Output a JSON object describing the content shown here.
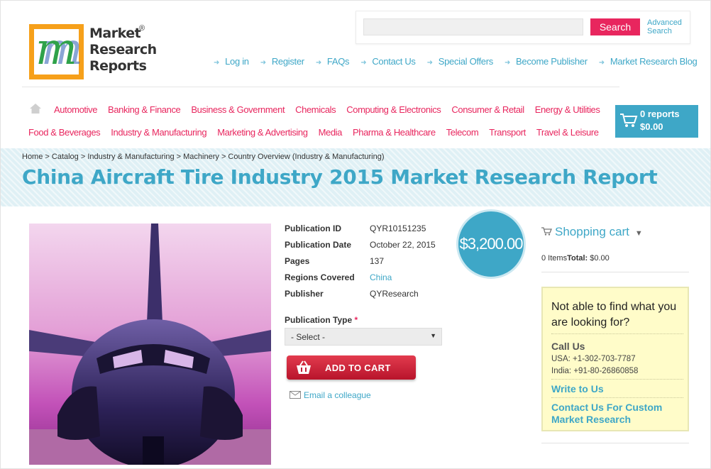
{
  "logo": {
    "line1": "Market",
    "line2": "Research",
    "line3": "Reports",
    "reg": "®",
    "mark": "m"
  },
  "search": {
    "button": "Search",
    "advanced_line1": "Advanced",
    "advanced_line2": "Search",
    "value": ""
  },
  "top_nav": [
    "Log in",
    "Register",
    "FAQs",
    "Contact Us",
    "Special Offers",
    "Become Publisher",
    "Market Research Blog"
  ],
  "categories_row1": [
    "Automotive",
    "Banking & Finance",
    "Business & Government",
    "Chemicals",
    "Computing & Electronics",
    "Consumer & Retail",
    "Energy & Utilities"
  ],
  "categories_row2": [
    "Food & Beverages",
    "Industry & Manufacturing",
    "Marketing & Advertising",
    "Media",
    "Pharma & Healthcare",
    "Telecom",
    "Transport",
    "Travel & Leisure"
  ],
  "cart": {
    "count": "0 reports",
    "total": "$0.00"
  },
  "breadcrumb": "Home > Catalog > Industry & Manufacturing > Machinery > Country Overview (Industry & Manufacturing)",
  "title": "China Aircraft Tire Industry 2015 Market Research Report",
  "info": {
    "pub_id_label": "Publication ID",
    "pub_id": "QYR10151235",
    "pub_date_label": "Publication Date",
    "pub_date": "October 22, 2015",
    "pages_label": "Pages",
    "pages": "137",
    "regions_label": "Regions Covered",
    "regions": "China",
    "publisher_label": "Publisher",
    "publisher": "QYResearch"
  },
  "price": "$3,200.00",
  "pub_type": {
    "label": "Publication Type",
    "required": "*",
    "selected": "- Select -"
  },
  "add_to_cart": "ADD TO CART",
  "email_colleague": "Email a colleague",
  "shopping_cart": {
    "title": "Shopping cart",
    "items": "0 Items",
    "total_label": "Total:",
    "total": "$0.00"
  },
  "help": {
    "question": "Not able to find what you are looking for?",
    "call_us": "Call Us",
    "usa": "USA: +1-302-703-7787",
    "india": "India: +91-80-26860858",
    "write": "Write to Us",
    "custom_line1": "Contact Us For Custom",
    "custom_line2": "Market Research"
  },
  "colors": {
    "accent": "#3ea7c7",
    "brand_pink": "#e8265e",
    "help_bg": "#fffcc9"
  }
}
